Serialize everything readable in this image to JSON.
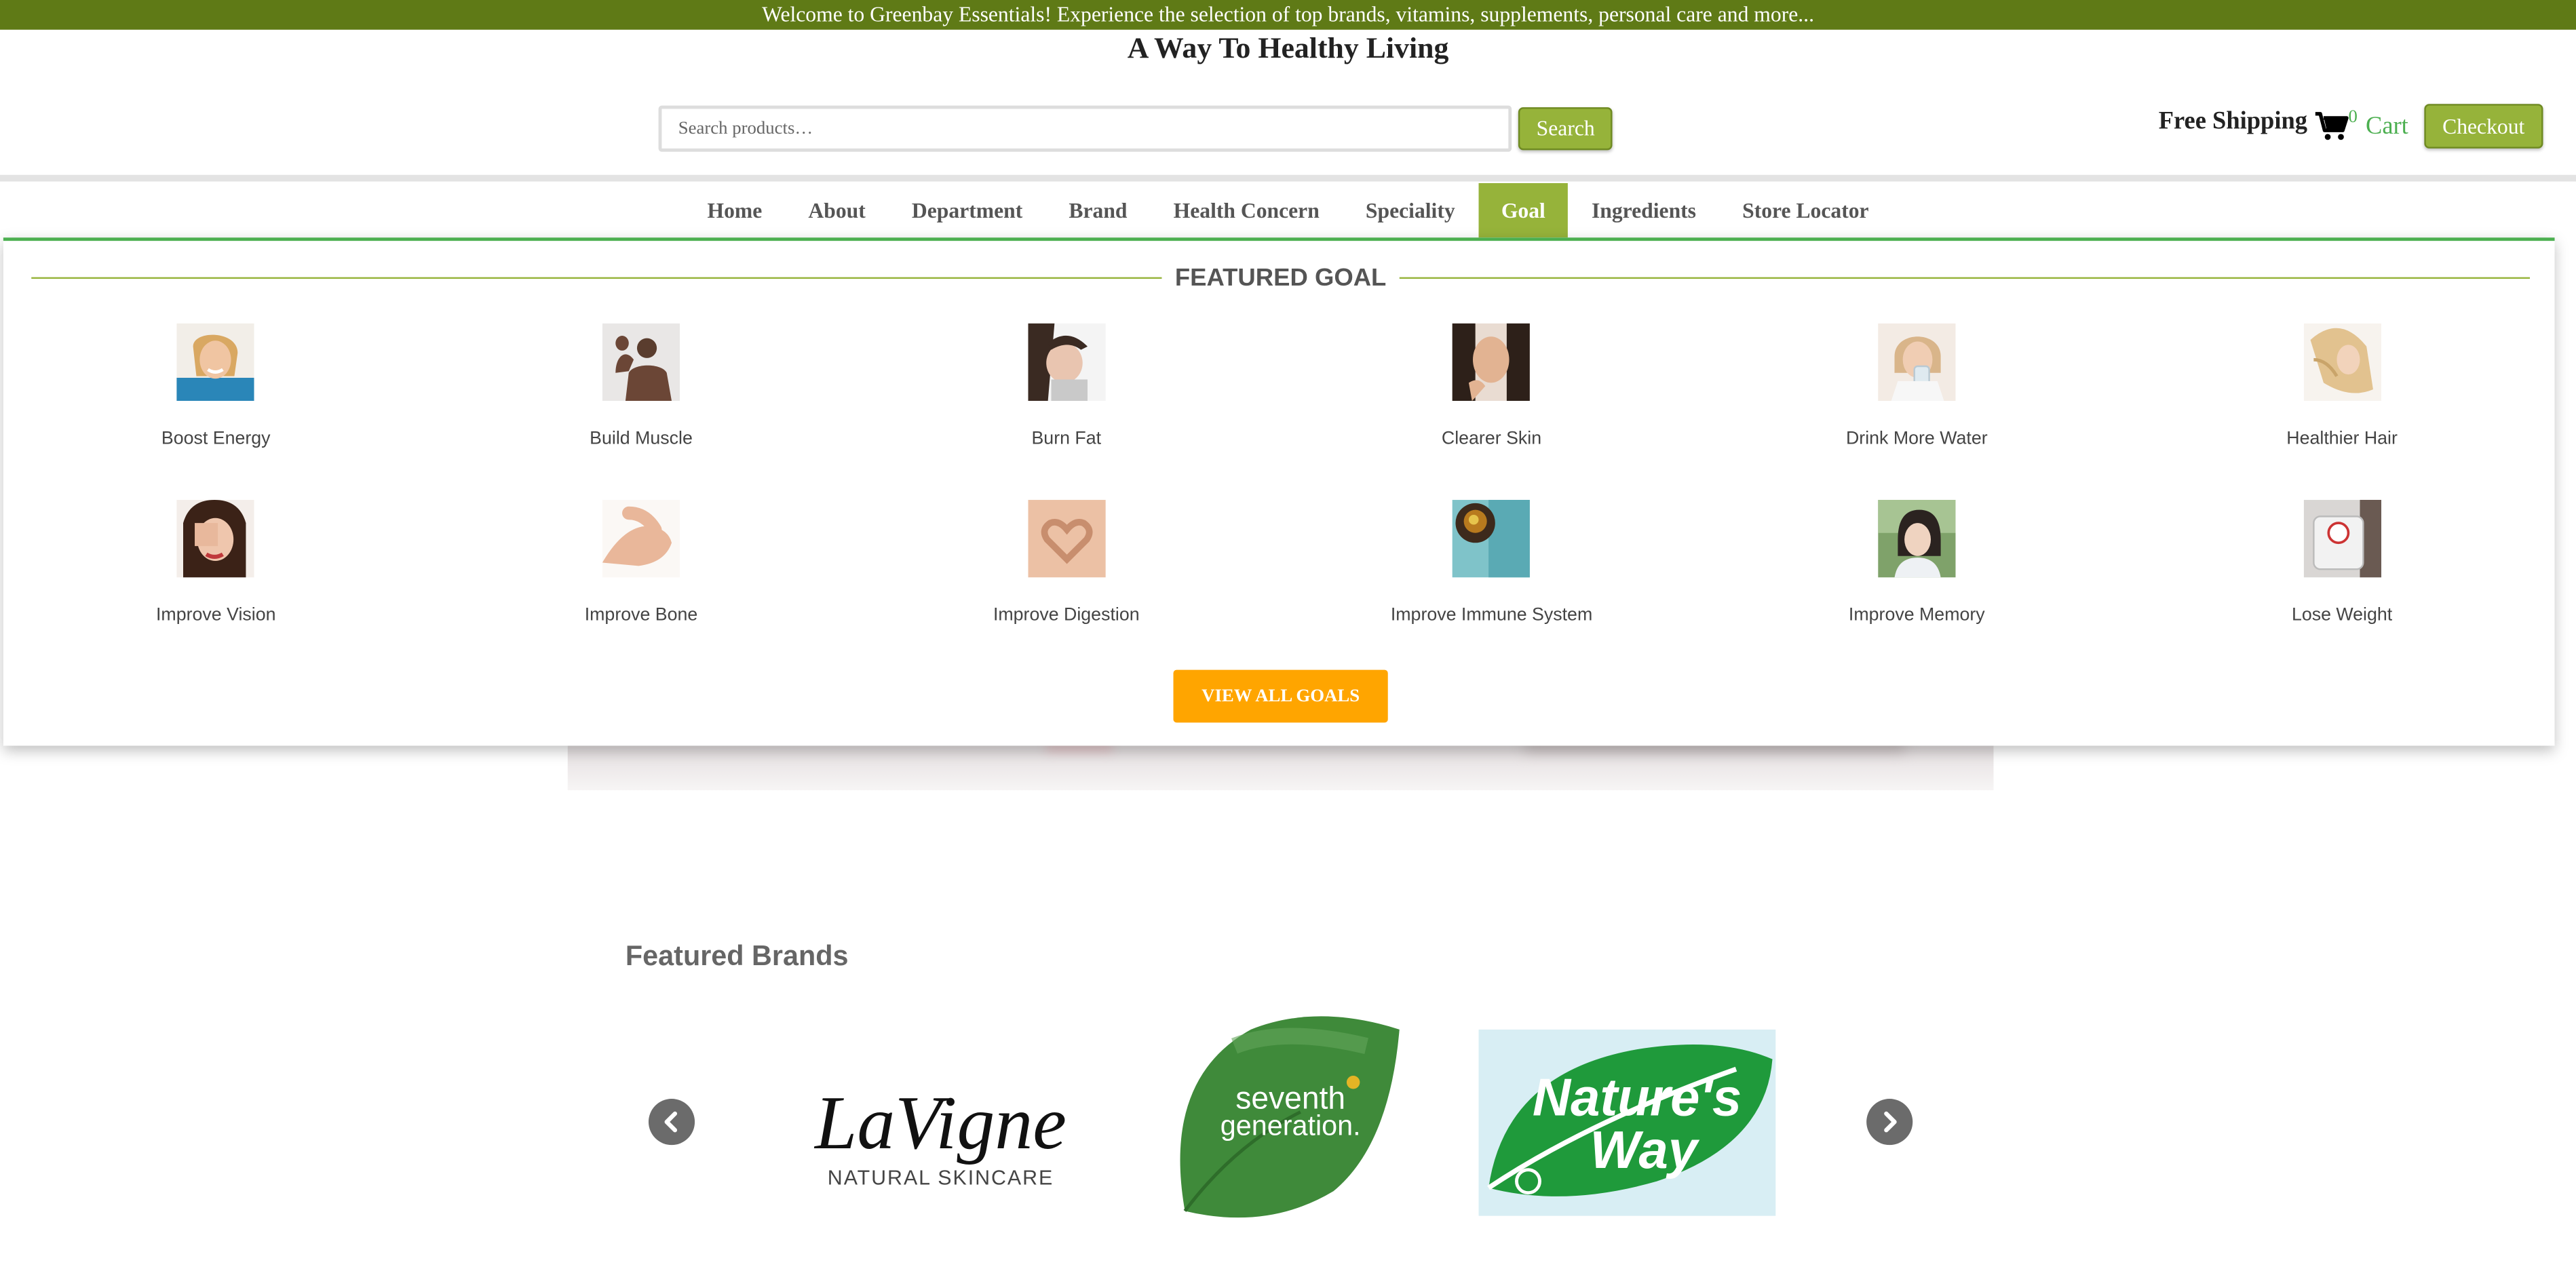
{
  "top_banner": {
    "text": "Welcome to Greenbay Essentials! Experience the selection of top brands, vitamins, supplements, personal care and more..."
  },
  "tagline": "A Way To Healthy Living",
  "search": {
    "placeholder": "Search products…",
    "button_label": "Search"
  },
  "header": {
    "free_shipping": "Free Shipping",
    "cart_count": "0",
    "cart_label": "Cart",
    "checkout_label": "Checkout"
  },
  "nav": {
    "items": [
      "Home",
      "About",
      "Department",
      "Brand",
      "Health Concern",
      "Speciality",
      "Goal",
      "Ingredients",
      "Store Locator"
    ],
    "active": "Goal"
  },
  "mega_menu": {
    "title": "FEATURED GOAL",
    "goals": [
      {
        "label": "Boost Energy",
        "icon": "smiling-woman-photo"
      },
      {
        "label": "Build Muscle",
        "icon": "flexing-man-photo"
      },
      {
        "label": "Burn Fat",
        "icon": "woman-resting-photo"
      },
      {
        "label": "Clearer Skin",
        "icon": "woman-face-photo"
      },
      {
        "label": "Drink More Water",
        "icon": "woman-drinking-water-photo"
      },
      {
        "label": "Healthier Hair",
        "icon": "woman-hair-photo"
      },
      {
        "label": "Improve Vision",
        "icon": "woman-covering-eye-photo"
      },
      {
        "label": "Improve Bone",
        "icon": "elbow-joint-photo"
      },
      {
        "label": "Improve Digestion",
        "icon": "heart-hands-belly-photo"
      },
      {
        "label": "Improve Immune System",
        "icon": "tea-and-scarf-photo"
      },
      {
        "label": "Improve Memory",
        "icon": "thinking-woman-photo"
      },
      {
        "label": "Lose Weight",
        "icon": "bathroom-scale-photo"
      }
    ],
    "view_all_label": "VIEW ALL GOALS"
  },
  "featured_brands": {
    "title": "Featured Brands",
    "brands": [
      {
        "name": "La Vigne",
        "line1": "LaVigne",
        "line2": "NATURAL SKINCARE"
      },
      {
        "name": "Seventh Generation",
        "line1": "seventh",
        "line2": "generation."
      },
      {
        "name": "Nature's Way",
        "line1": "Nature's",
        "line2": "Way"
      }
    ]
  },
  "colors": {
    "topbar": "#5f7a16",
    "accent_green": "#96b33a",
    "menu_border": "#4caf50",
    "view_all": "#ffa500"
  }
}
